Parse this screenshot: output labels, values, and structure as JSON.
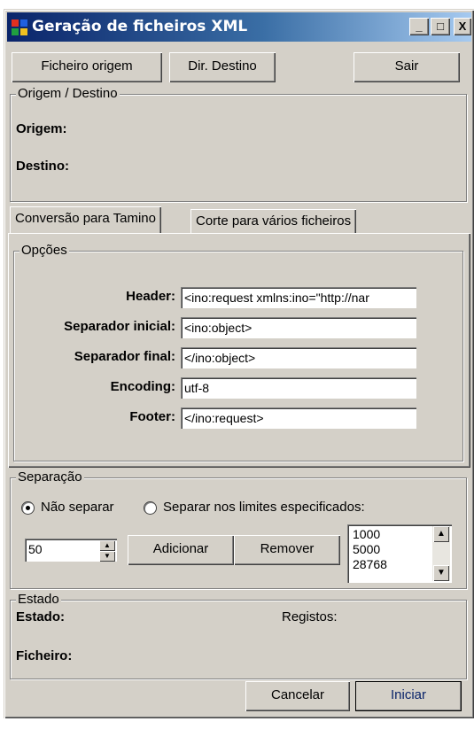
{
  "window": {
    "title": "Geração de ficheiros XML",
    "minimize": "_",
    "maximize": "□",
    "close": "X"
  },
  "toolbar": {
    "source_label": "Ficheiro origem",
    "dest_label": "Dir. Destino",
    "exit_label": "Sair"
  },
  "origin_group": {
    "legend": "Origem / Destino",
    "origin_label": "Origem:",
    "dest_label": "Destino:"
  },
  "tabs": [
    {
      "label": "Conversão para Tamino"
    },
    {
      "label": "Corte para vários ficheiros"
    }
  ],
  "options": {
    "legend": "Opções",
    "fields": [
      {
        "label": "Header:",
        "value": "<ino:request xmlns:ino=\"http://nar"
      },
      {
        "label": "Separador inicial:",
        "value": "<ino:object>"
      },
      {
        "label": "Separador final:",
        "value": "</ino:object>"
      },
      {
        "label": "Encoding:",
        "value": "utf-8"
      },
      {
        "label": "Footer:",
        "value": "</ino:request>"
      }
    ]
  },
  "separation": {
    "legend": "Separação",
    "radio_no_separate": "Não separar",
    "radio_separate_limits": "Separar nos limites especificados:",
    "selected": "Não separar",
    "spinner_value": "50",
    "add_label": "Adicionar",
    "remove_label": "Remover",
    "limits": [
      "1000",
      "5000",
      "28768"
    ]
  },
  "state": {
    "legend": "Estado",
    "state_label": "Estado:",
    "records_label": "Registos:",
    "file_label": "Ficheiro:"
  },
  "footer": {
    "cancel_label": "Cancelar",
    "start_label": "Iniciar"
  },
  "colors": {
    "title_gradient_start": "#0a246a",
    "title_gradient_end": "#a6caf0",
    "face": "#d4d0c8",
    "start_text": "#0a246a"
  }
}
